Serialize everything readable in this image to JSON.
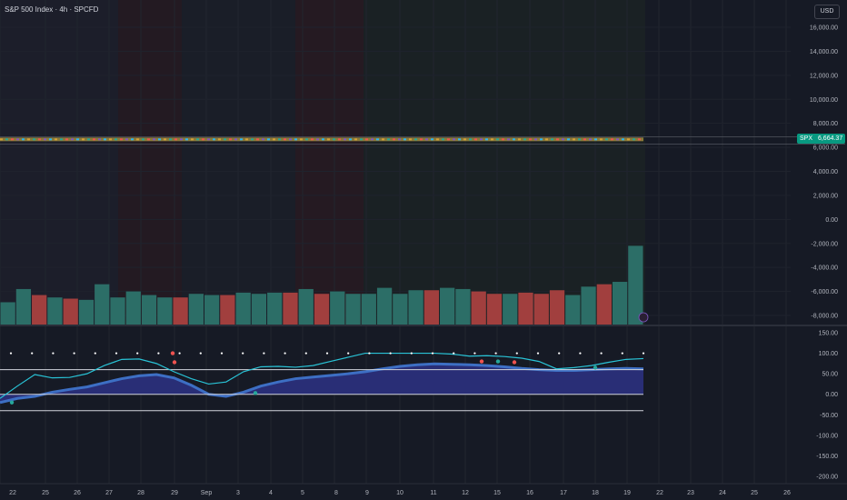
{
  "header": {
    "title": "S&P 500 Index · 4h · SPCFD",
    "currency": "USD"
  },
  "price_tag": {
    "symbol": "SPX",
    "value": "6,664.37"
  },
  "colors": {
    "background": "#161a25",
    "bull": "#26a69a",
    "bear": "#ef5350",
    "histogram_bull": "#2c6e67",
    "histogram_bear": "#a13f3e",
    "wave_line": "#29c3d6",
    "wave_fill": "#2a2f7a",
    "wave_fill_light": "#3d6fc4",
    "tag_green": "#089981"
  },
  "chart_data": [
    {
      "type": "line",
      "name": "price_pane",
      "yticks": [
        "16,000.00",
        "14,000.00",
        "12,000.00",
        "10,000.00",
        "8,000.00",
        "6,000.00",
        "4,000.00",
        "2,000.00",
        "0.00",
        "-2,000.00",
        "-4,000.00",
        "-6,000.00",
        "-8,000.00"
      ],
      "ylim": [
        -8000,
        16000
      ],
      "last_value": 6664.37
    },
    {
      "type": "bar",
      "name": "histogram_pane",
      "values": [
        -6900,
        -5800,
        -6300,
        -6500,
        -6600,
        -6700,
        -5400,
        -6500,
        -6000,
        -6300,
        -6500,
        -6500,
        -6200,
        -6300,
        -6300,
        -6100,
        -6200,
        -6100,
        -6100,
        -5800,
        -6200,
        -6000,
        -6200,
        -6200,
        -5700,
        -6200,
        -5900,
        -5900,
        -5700,
        -5800,
        -6000,
        -6200,
        -6200,
        -6100,
        -6200,
        -5900,
        -6300,
        -5600,
        -5400,
        -5200,
        -2200
      ],
      "signs": [
        "bull",
        "bull",
        "bear",
        "bull",
        "bear",
        "bull",
        "bull",
        "bull",
        "bull",
        "bull",
        "bull",
        "bear",
        "bull",
        "bull",
        "bear",
        "bull",
        "bull",
        "bull",
        "bear",
        "bull",
        "bear",
        "bull",
        "bull",
        "bull",
        "bull",
        "bull",
        "bull",
        "bear",
        "bull",
        "bull",
        "bear",
        "bear",
        "bull",
        "bear",
        "bear",
        "bear",
        "bull",
        "bull",
        "bear",
        "bull",
        "bull"
      ]
    },
    {
      "type": "line",
      "name": "oscillator_pane",
      "yticks": [
        "150.00",
        "100.00",
        "50.00",
        "0.00",
        "-50.00",
        "-100.00",
        "-150.00",
        "-200.00"
      ],
      "ylim": [
        -200,
        150
      ],
      "levels": [
        60,
        0,
        -40
      ],
      "wave1": [
        -10,
        20,
        48,
        40,
        41,
        50,
        70,
        85,
        86,
        75,
        55,
        38,
        25,
        30,
        55,
        67,
        68,
        66,
        70,
        80,
        90,
        100,
        100,
        100,
        100,
        100,
        98,
        93,
        94,
        92,
        88,
        80,
        62,
        65,
        70,
        78,
        85,
        87
      ],
      "wave2": [
        -20,
        -10,
        -5,
        5,
        12,
        18,
        28,
        38,
        45,
        48,
        40,
        22,
        0,
        -5,
        5,
        20,
        30,
        38,
        42,
        46,
        50,
        55,
        62,
        68,
        72,
        74,
        73,
        72,
        70,
        67,
        63,
        60,
        58,
        58,
        60,
        62,
        63,
        62
      ]
    }
  ],
  "x_axis": {
    "labels": [
      "22",
      "25",
      "26",
      "27",
      "28",
      "29",
      "Sep",
      "3",
      "4",
      "5",
      "8",
      "9",
      "10",
      "11",
      "12",
      "15",
      "16",
      "17",
      "18",
      "19",
      "22",
      "23",
      "24",
      "25",
      "26"
    ]
  }
}
